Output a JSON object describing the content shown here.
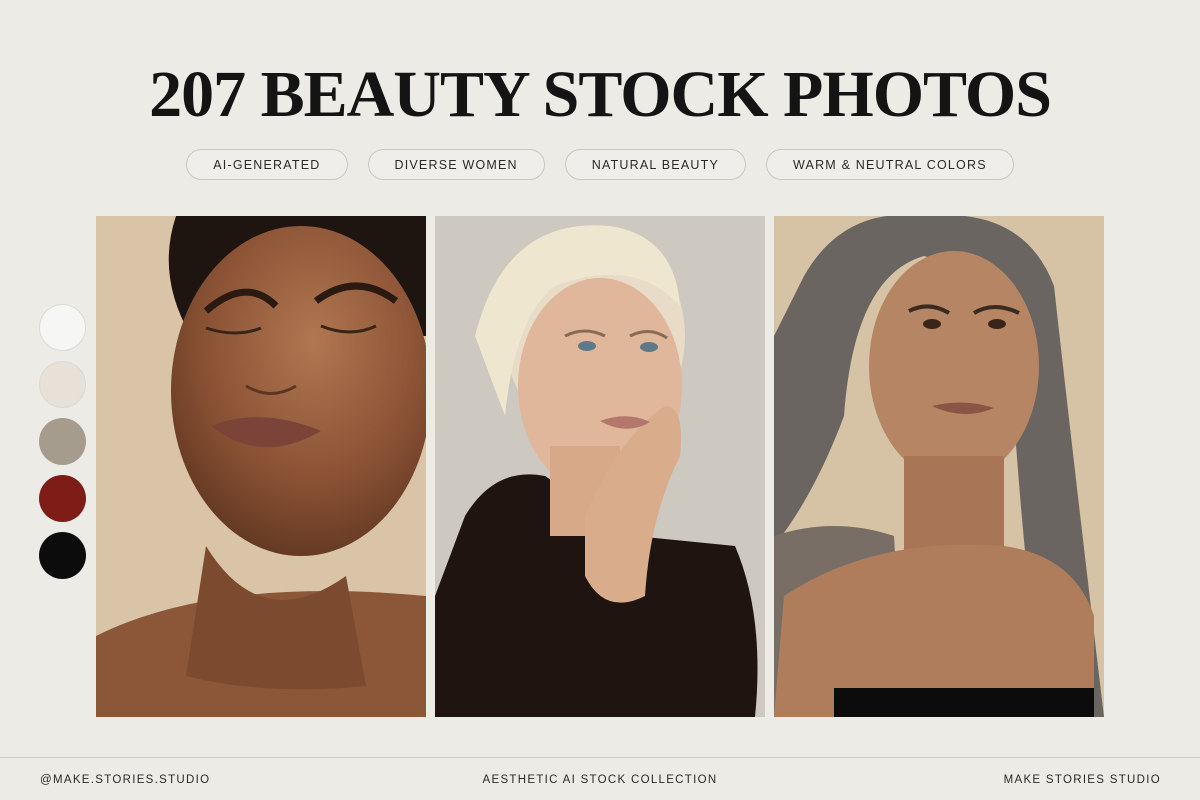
{
  "title": "207 BEAUTY STOCK PHOTOS",
  "tags": [
    "AI-GENERATED",
    "DIVERSE WOMEN",
    "NATURAL BEAUTY",
    "WARM & NEUTRAL COLORS"
  ],
  "swatches": [
    "#f6f6f4",
    "#e7e1d8",
    "#a59c8d",
    "#7e1c17",
    "#0c0c0c"
  ],
  "photos": [
    {
      "subject": "woman-eyes-closed",
      "bg": "#d9c4a8"
    },
    {
      "subject": "older-woman-blonde",
      "bg": "#cdc8c0"
    },
    {
      "subject": "woman-long-grey-hair",
      "bg": "#d6c2a5"
    }
  ],
  "footer": {
    "left": "@MAKE.STORIES.STUDIO",
    "center": "AESTHETIC AI STOCK COLLECTION",
    "right": "MAKE STORIES STUDIO"
  }
}
